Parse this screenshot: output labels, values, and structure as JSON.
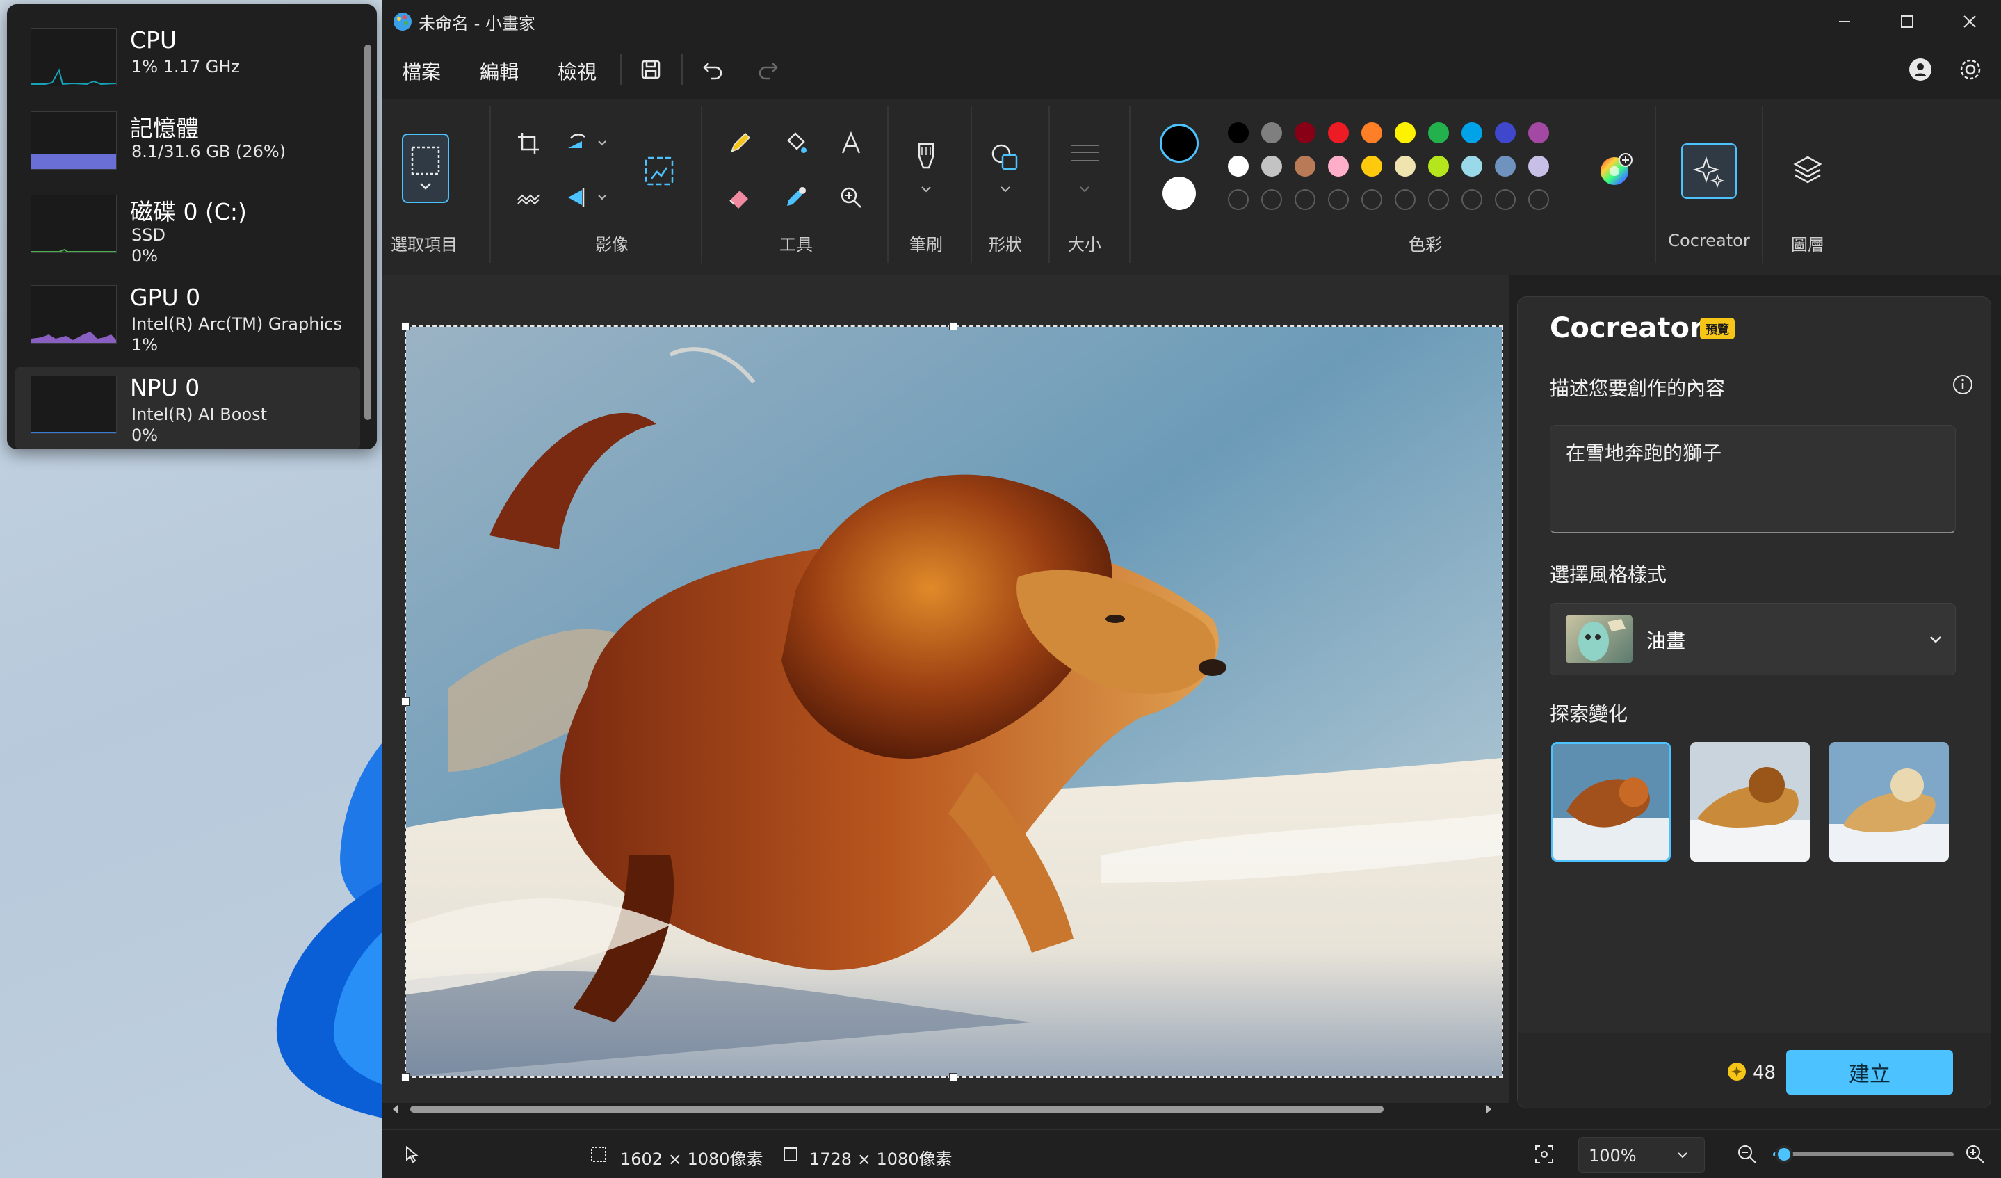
{
  "perf": {
    "items": [
      {
        "name": "CPU",
        "sub1": "1% 1.17 GHz",
        "sub2": ""
      },
      {
        "name": "記憶體",
        "sub1": "8.1/31.6 GB (26%)",
        "sub2": ""
      },
      {
        "name": "磁碟 0 (C:)",
        "sub1": "SSD",
        "sub2": "0%"
      },
      {
        "name": "GPU 0",
        "sub1": "Intel(R) Arc(TM) Graphics",
        "sub2": "1%"
      },
      {
        "name": "NPU 0",
        "sub1": "Intel(R) AI Boost",
        "sub2": "0%"
      }
    ]
  },
  "window": {
    "title": "未命名 - 小畫家"
  },
  "menu": {
    "file": "檔案",
    "edit": "編輯",
    "view": "檢視"
  },
  "ribbon": {
    "selection_label": "選取項目",
    "image_label": "影像",
    "tools_label": "工具",
    "brush_label": "筆刷",
    "shapes_label": "形狀",
    "size_label": "大小",
    "colors_label": "色彩",
    "cocreator_label": "Cocreator",
    "layers_label": "圖層"
  },
  "palette": {
    "primary": "#000000",
    "secondary": "#ffffff",
    "row1": [
      "#000000",
      "#7f7f7f",
      "#880015",
      "#ed1c24",
      "#ff7f27",
      "#fff200",
      "#22b14c",
      "#00a2e8",
      "#3f48cc",
      "#a349a4"
    ],
    "row2": [
      "#ffffff",
      "#c3c3c3",
      "#b97a57",
      "#ffaec9",
      "#ffc90e",
      "#efe4b0",
      "#b5e61d",
      "#99d9ea",
      "#7092be",
      "#c8bfe7"
    ],
    "row3_count": 10
  },
  "cocreator": {
    "title": "Cocreator",
    "badge": "預覽",
    "desc_label": "描述您要創作的內容",
    "prompt": "在雪地奔跑的獅子",
    "style_label": "選擇風格樣式",
    "style_value": "油畫",
    "explore_label": "探索變化",
    "credits": "48",
    "create_label": "建立"
  },
  "status": {
    "selection_size": "1602 × 1080像素",
    "canvas_size": "1728 × 1080像素",
    "zoom": "100%",
    "zoom_level": 0.06
  },
  "colors": {
    "accent": "#4cc2ff",
    "badge": "#f5c518"
  }
}
